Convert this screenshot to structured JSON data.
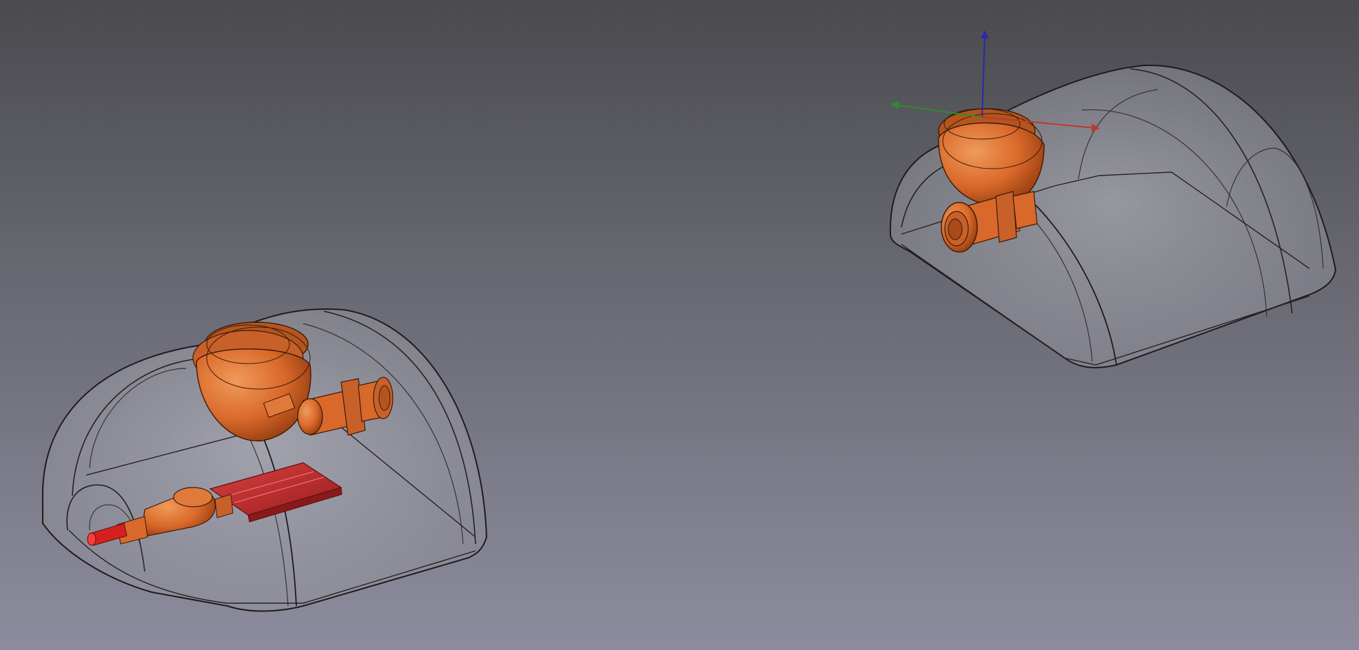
{
  "scene": {
    "app": "3D CAD viewport",
    "objects": [
      {
        "name": "enclosure-assembly-left",
        "components": [
          "transparent-dome-shell",
          "orange-cylindrical-motor",
          "orange-connector",
          "orange-usb-connector",
          "red-circuit-board",
          "red-cable-end"
        ]
      },
      {
        "name": "enclosure-assembly-right",
        "components": [
          "transparent-dome-shell",
          "orange-cylindrical-motor",
          "orange-connector"
        ]
      }
    ],
    "axes": {
      "x_color": "#c0392b",
      "y_color": "#2e8b2e",
      "z_color": "#2a2aa8"
    },
    "colors": {
      "background_top": "#4a4a4f",
      "background_bottom": "#8c8c9e",
      "shell_fill": "#a9a9b3",
      "part_orange": "#d9692a",
      "part_red": "#c72a2a"
    }
  }
}
